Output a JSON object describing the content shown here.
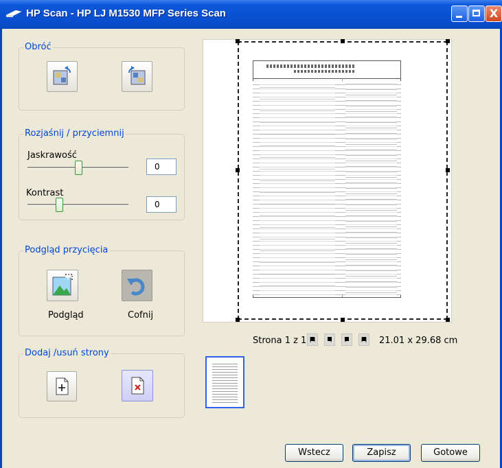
{
  "window": {
    "title": "HP Scan - HP LJ M1530 MFP Series Scan",
    "close_glyph": "X"
  },
  "rotate": {
    "legend": "Obróć",
    "left_icon": "rotate-left-icon",
    "right_icon": "rotate-right-icon"
  },
  "adjust": {
    "legend": "Rozjaśnij / przyciemnij",
    "brightness_label": "Jaskrawość",
    "brightness_value": "0",
    "contrast_label": "Kontrast",
    "contrast_value": "0"
  },
  "crop_preview": {
    "legend": "Podgląd przycięcia",
    "preview_label": "Podgląd",
    "undo_label": "Cofnij"
  },
  "pages": {
    "legend": "Dodaj /usuń strony",
    "add_icon": "add-page-icon",
    "remove_icon": "remove-page-icon"
  },
  "pager": {
    "page_text": "Strona 1 z 1",
    "dimensions": "21.01 x 29.68 cm"
  },
  "buttons": {
    "back": "Wstecz",
    "save": "Zapisz",
    "done": "Gotowe"
  },
  "colors": {
    "titlebar": "#0b56d8",
    "legend_text": "#0046d5",
    "window_bg": "#ece9d8"
  }
}
